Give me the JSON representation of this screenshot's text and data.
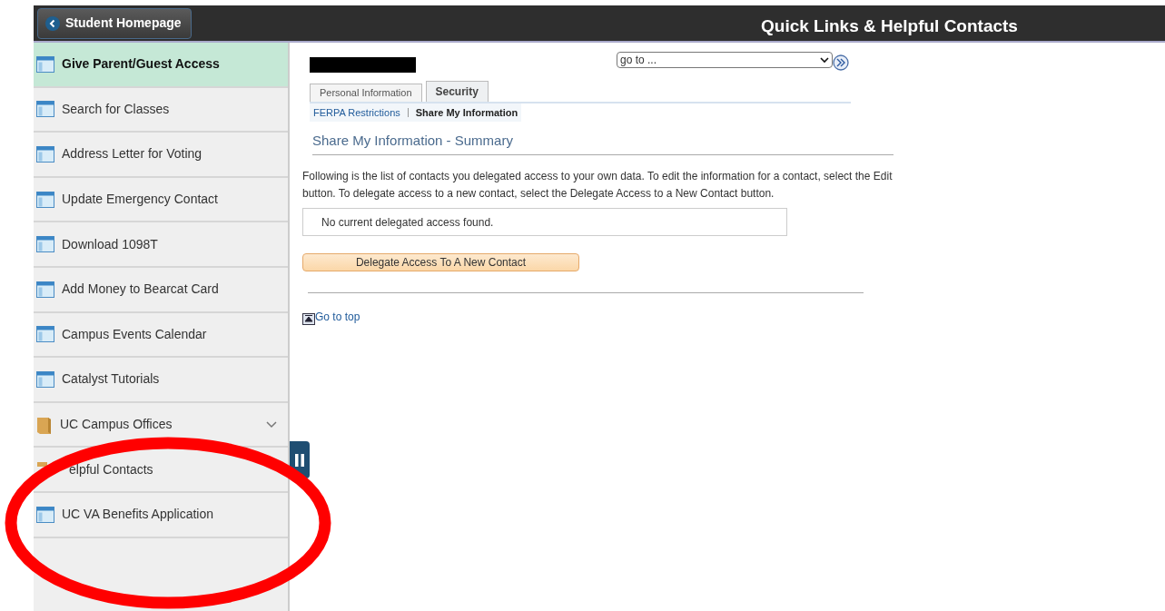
{
  "header": {
    "back_button": "Student Homepage",
    "title": "Quick Links & Helpful Contacts"
  },
  "sidebar": {
    "items": [
      {
        "label": "Give Parent/Guest Access",
        "kind": "page",
        "selected": true
      },
      {
        "label": "Search for Classes",
        "kind": "page",
        "selected": false
      },
      {
        "label": "Address Letter for Voting",
        "kind": "page",
        "selected": false
      },
      {
        "label": "Update Emergency Contact",
        "kind": "page",
        "selected": false
      },
      {
        "label": "Download 1098T",
        "kind": "page",
        "selected": false
      },
      {
        "label": "Add Money to Bearcat Card",
        "kind": "page",
        "selected": false
      },
      {
        "label": "Campus Events Calendar",
        "kind": "page",
        "selected": false
      },
      {
        "label": "Catalyst Tutorials",
        "kind": "page",
        "selected": false
      },
      {
        "label": "UC Campus Offices",
        "kind": "folder",
        "selected": false,
        "expanded": false
      },
      {
        "label": "elpful Contacts",
        "kind": "folder",
        "selected": false
      },
      {
        "label": "UC VA Benefits Application",
        "kind": "page",
        "selected": false
      }
    ]
  },
  "goto": {
    "value": "go to ..."
  },
  "tabs": [
    {
      "label": "Personal Information",
      "selected": false
    },
    {
      "label": "Security",
      "selected": true
    }
  ],
  "subtabs": [
    {
      "label": "FERPA Restrictions",
      "selected": false
    },
    {
      "label": "Share My Information",
      "selected": true
    }
  ],
  "section_title": "Share My Information - Summary",
  "instructions": "Following is the list of contacts you delegated access to your own data. To edit the information for a contact, select the Edit button. To delegate access to a new contact, select the Delegate Access to a New Contact button.",
  "empty_message": "No current delegated access found.",
  "delegate_button": "Delegate Access To A New Contact",
  "go_to_top": "Go to top"
}
